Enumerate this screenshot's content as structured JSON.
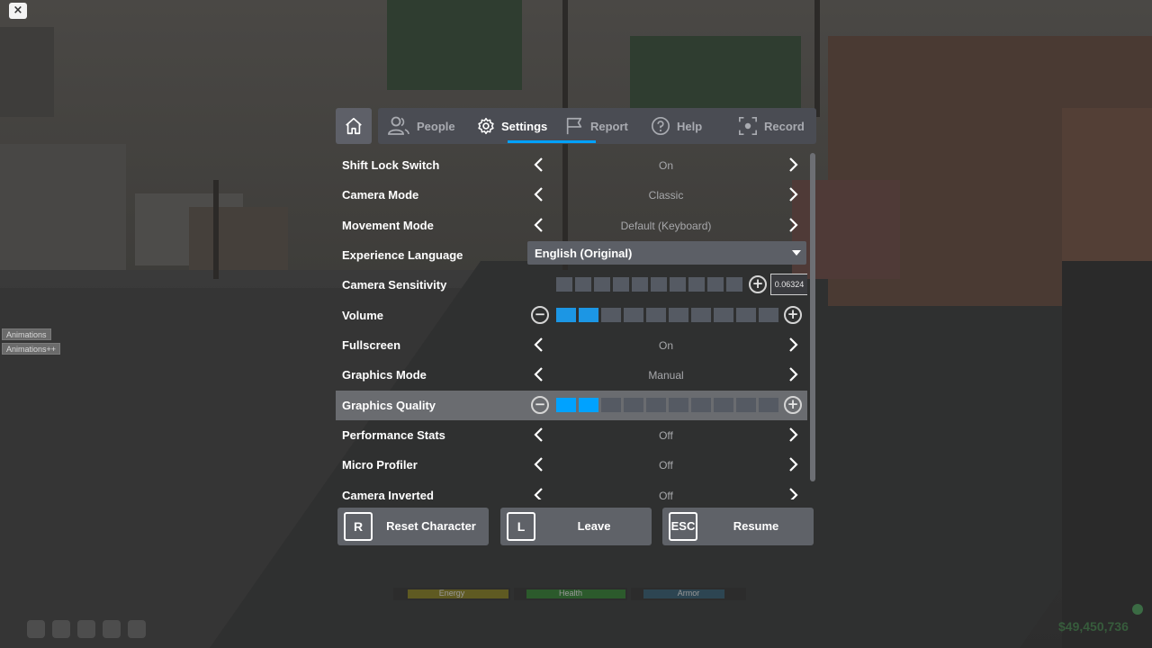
{
  "tabs": {
    "home_icon": "home-icon",
    "items": [
      {
        "label": "People",
        "icon": "people-icon"
      },
      {
        "label": "Settings",
        "icon": "gear-icon"
      },
      {
        "label": "Report",
        "icon": "flag-icon"
      },
      {
        "label": "Help",
        "icon": "question-icon"
      },
      {
        "label": "Record",
        "icon": "record-icon"
      }
    ],
    "active": "Settings"
  },
  "settings": {
    "shift_lock": {
      "label": "Shift Lock Switch",
      "value": "On"
    },
    "camera_mode": {
      "label": "Camera Mode",
      "value": "Classic"
    },
    "movement_mode": {
      "label": "Movement Mode",
      "value": "Default (Keyboard)"
    },
    "language": {
      "label": "Experience Language",
      "value": "English (Original)"
    },
    "camera_sensitivity": {
      "label": "Camera Sensitivity",
      "value": "0.06324",
      "level": 0
    },
    "volume": {
      "label": "Volume",
      "level": 2,
      "max": 10
    },
    "fullscreen": {
      "label": "Fullscreen",
      "value": "On"
    },
    "graphics_mode": {
      "label": "Graphics Mode",
      "value": "Manual"
    },
    "graphics_quality": {
      "label": "Graphics Quality",
      "level": 2,
      "max": 10
    },
    "performance_stats": {
      "label": "Performance Stats",
      "value": "Off"
    },
    "micro_profiler": {
      "label": "Micro Profiler",
      "value": "Off"
    },
    "camera_inverted": {
      "label": "Camera Inverted",
      "value": "Off"
    }
  },
  "buttons": {
    "reset": {
      "key": "R",
      "label": "Reset Character"
    },
    "leave": {
      "key": "L",
      "label": "Leave"
    },
    "resume": {
      "key": "ESC",
      "label": "Resume"
    }
  },
  "overlay": {
    "close": "×",
    "animations": "Animations",
    "animations_plus": "Animations++"
  },
  "hud": {
    "energy": "Energy",
    "health": "Health",
    "armor": "Armor",
    "money": "$49,450,736"
  },
  "colors": {
    "accent": "#00a2ff",
    "slider_on": "#1c96e4",
    "panel": "#4a4c53"
  }
}
